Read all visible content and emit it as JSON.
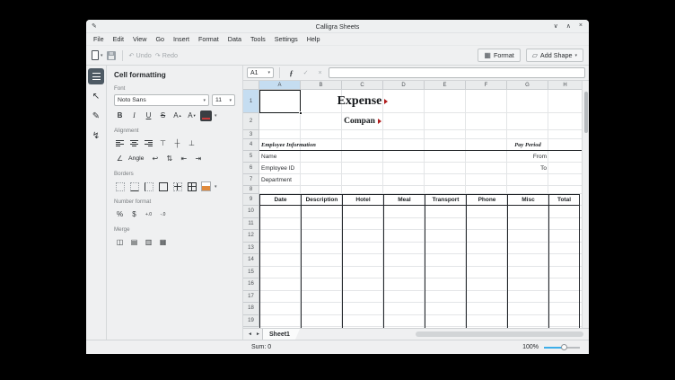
{
  "titlebar": {
    "title": "Calligra Sheets"
  },
  "icons": {
    "app": "✎",
    "minimize": "∨",
    "maximize": "∧",
    "close": "×",
    "dropdown": "▾",
    "undo": "↶",
    "redo": "↷",
    "format": "▦",
    "add_shape": "▱",
    "fx": "ƒ",
    "apply": "✓",
    "cancel": "×",
    "tab_prev": "◄",
    "tab_next": "►",
    "angle": "∠"
  },
  "menubar": [
    "File",
    "Edit",
    "View",
    "Go",
    "Insert",
    "Format",
    "Data",
    "Tools",
    "Settings",
    "Help"
  ],
  "toolbar": {
    "undo_label": "Undo",
    "redo_label": "Redo",
    "format_label": "Format",
    "add_shape_label": "Add Shape"
  },
  "toolbox": [
    {
      "name": "cell-format",
      "bars": true,
      "active": true
    },
    {
      "name": "pointer",
      "glyph": "↖"
    },
    {
      "name": "freehand",
      "glyph": "✎"
    },
    {
      "name": "connector",
      "glyph": "↯"
    }
  ],
  "docker": {
    "title": "Cell formatting",
    "font": {
      "label": "Font",
      "family": "Noto Sans",
      "size": "11",
      "styles": [
        {
          "name": "bold",
          "glyph": "B"
        },
        {
          "name": "italic",
          "glyph": "I"
        },
        {
          "name": "underline",
          "glyph": "U"
        },
        {
          "name": "strikethrough",
          "glyph": "S"
        },
        {
          "name": "grow-font",
          "glyph": "A",
          "sub": "▴"
        },
        {
          "name": "shrink-font",
          "glyph": "A",
          "sub": "▾"
        }
      ]
    },
    "alignment": {
      "label": "Alignment",
      "angle_label": "Angle",
      "horizontal": [
        "align-left",
        "align-center",
        "align-right"
      ],
      "vertical": [
        {
          "name": "align-top",
          "glyph": "⊤"
        },
        {
          "name": "align-middle",
          "glyph": "┼"
        },
        {
          "name": "align-bottom",
          "glyph": "⊥"
        }
      ],
      "extras": [
        {
          "name": "wrap-text",
          "glyph": "↩"
        },
        {
          "name": "vertical-text",
          "glyph": "⇅"
        },
        {
          "name": "decrease-indent",
          "glyph": "⇤"
        },
        {
          "name": "increase-indent",
          "glyph": "⇥"
        }
      ]
    },
    "borders": {
      "label": "Borders",
      "buttons": [
        "none",
        "bottom",
        "left",
        "outer",
        "inner",
        "all"
      ],
      "swatch_color": "#e08a3c"
    },
    "number": {
      "label": "Number format",
      "buttons": [
        {
          "name": "percent",
          "glyph": "%"
        },
        {
          "name": "currency",
          "glyph": "$"
        },
        {
          "name": "increase-precision",
          "glyph": "+.0",
          "small": true
        },
        {
          "name": "decrease-precision",
          "glyph": "-.0",
          "small": true
        }
      ]
    },
    "merge": {
      "label": "Merge",
      "buttons": [
        {
          "name": "merge-cells",
          "glyph": "◫"
        },
        {
          "name": "merge-horizontal",
          "glyph": "▤"
        },
        {
          "name": "merge-vertical",
          "glyph": "▥"
        },
        {
          "name": "dissociate-cells",
          "glyph": "▦"
        }
      ]
    }
  },
  "formula_bar": {
    "cell_ref": "A1"
  },
  "sheet": {
    "columns": [
      "A",
      "B",
      "C",
      "D",
      "E",
      "F",
      "G",
      "H"
    ],
    "row_labels": [
      "1",
      "2",
      "3",
      "4",
      "5",
      "6",
      "7",
      "8",
      "9",
      "10",
      "11",
      "12",
      "13",
      "14",
      "15",
      "16",
      "17",
      "18",
      "19"
    ],
    "selected": {
      "cell": "A1",
      "column": "A",
      "row": "1"
    },
    "section_rule_row": 4,
    "contents": [
      {
        "row": 1,
        "col": 1,
        "span": 3,
        "align": "center",
        "style": "title",
        "text": "Expense",
        "overflow": true
      },
      {
        "row": 2,
        "col": 1,
        "span": 3,
        "align": "center",
        "style": "subtitle",
        "text": "Compan",
        "overflow": true
      },
      {
        "row": 4,
        "col": 0,
        "span": 3,
        "align": "left",
        "style": "section",
        "text": "Employee Information"
      },
      {
        "row": 4,
        "col": 6,
        "span": 1,
        "align": "center",
        "style": "section",
        "text": "Pay Period"
      },
      {
        "row": 5,
        "col": 0,
        "span": 2,
        "align": "left",
        "style": "plain",
        "text": "Name"
      },
      {
        "row": 5,
        "col": 6,
        "span": 1,
        "align": "right",
        "style": "plain",
        "text": "From"
      },
      {
        "row": 6,
        "col": 0,
        "span": 2,
        "align": "left",
        "style": "plain",
        "text": "Employee ID"
      },
      {
        "row": 6,
        "col": 6,
        "span": 1,
        "align": "right",
        "style": "plain",
        "text": "To"
      },
      {
        "row": 7,
        "col": 0,
        "span": 2,
        "align": "left",
        "style": "plain",
        "text": "Department"
      }
    ],
    "table": {
      "header_row": 9,
      "headers": [
        "Date",
        "Description",
        "Hotel",
        "Meal",
        "Transport",
        "Phone",
        "Misc",
        "Total"
      ]
    }
  },
  "tab_bar": {
    "tabs": [
      {
        "name": "Sheet1",
        "active": true
      }
    ]
  },
  "status_bar": {
    "sum": "Sum: 0",
    "zoom": "100%"
  },
  "colors": {
    "accent": "#3daee9",
    "selection_header": "#c5ddf1",
    "overflow_arrow": "#b01c1c",
    "table_border": "#23262a"
  }
}
